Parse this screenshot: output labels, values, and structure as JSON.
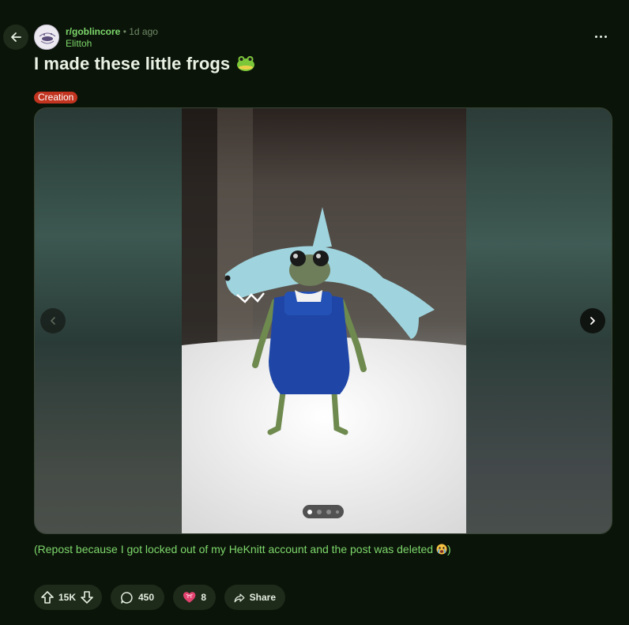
{
  "header": {
    "subreddit": "r/goblincore",
    "separator": "•",
    "time_ago": "1d ago",
    "author": "Elittoh"
  },
  "post": {
    "title": "I made these little frogs",
    "title_emoji": "frog-face-icon",
    "flair": "Creation",
    "body": "(Repost because I got locked out of my HeKnitt account and the post was deleted",
    "body_emoji": "crying-face-icon",
    "body_suffix": ")"
  },
  "gallery": {
    "current_index": 1,
    "total": 4
  },
  "actions": {
    "score": "15K",
    "comments": "450",
    "awards": "8",
    "share": "Share"
  },
  "colors": {
    "background": "#0b1409",
    "accent_green": "#7dd86b",
    "flair_red": "#c2341f",
    "pill_bg": "#1e2a1a"
  }
}
